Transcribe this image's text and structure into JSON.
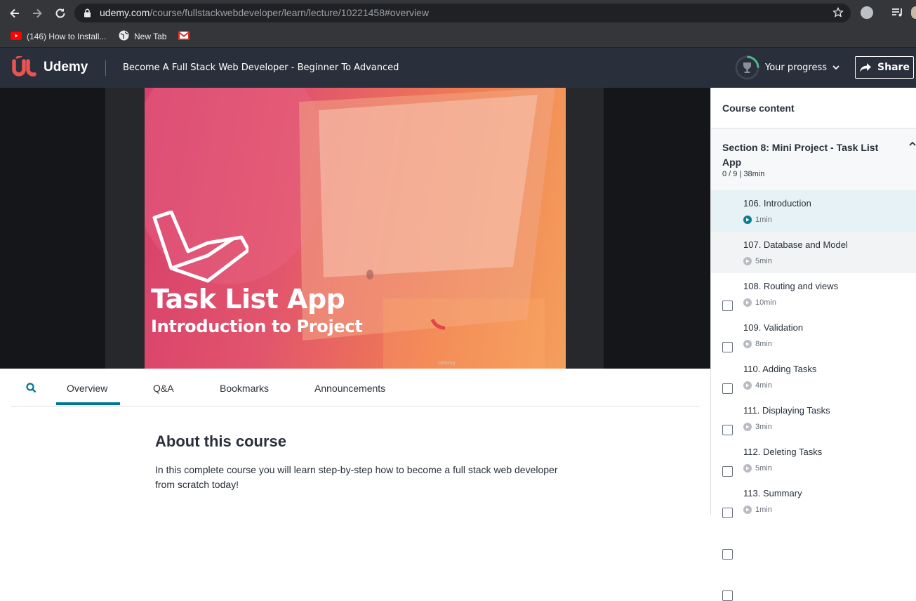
{
  "browser": {
    "url_host": "udemy.com",
    "url_path": "/course/fullstackwebdeveloper/learn/lecture/10221458#overview",
    "bookmarks": [
      {
        "label": "(146) How to Install...",
        "icon": "youtube-icon"
      },
      {
        "label": "New Tab",
        "icon": "globe-icon"
      },
      {
        "label": "",
        "icon": "gmail-icon"
      }
    ]
  },
  "header": {
    "logo_text": "Udemy",
    "course_title": "Become A Full Stack Web Developer - Beginner To Advanced",
    "progress_label": "Your progress",
    "share_label": "Share"
  },
  "video": {
    "title": "Task List App",
    "subtitle": "Introduction to Project",
    "watermark": "Udemy"
  },
  "tabs": [
    {
      "label": "Overview",
      "active": true
    },
    {
      "label": "Q&A",
      "active": false
    },
    {
      "label": "Bookmarks",
      "active": false
    },
    {
      "label": "Announcements",
      "active": false
    }
  ],
  "overview": {
    "heading": "About this course",
    "description": "In this complete course you will learn step-by-step how to become a full stack web developer from scratch today!"
  },
  "sidebar": {
    "title": "Course content",
    "section": {
      "title": "Section 8: Mini Project - Task List App",
      "meta": "0 / 9 | 38min"
    },
    "lectures": [
      {
        "title": "106. Introduction",
        "duration": "1min",
        "current": true
      },
      {
        "title": "107. Database and Model",
        "duration": "5min",
        "current": false
      },
      {
        "title": "108. Routing and views",
        "duration": "10min",
        "current": false
      },
      {
        "title": "109. Validation",
        "duration": "8min",
        "current": false
      },
      {
        "title": "110. Adding Tasks",
        "duration": "4min",
        "current": false
      },
      {
        "title": "111. Displaying Tasks",
        "duration": "3min",
        "current": false
      },
      {
        "title": "112. Deleting Tasks",
        "duration": "5min",
        "current": false
      },
      {
        "title": "113. Summary",
        "duration": "1min",
        "current": false
      }
    ]
  },
  "colors": {
    "udemy_red": "#ec5252",
    "header_bg": "#29303b",
    "accent_teal": "#007791",
    "current_row_bg": "#e6f2f5",
    "hover_row_bg": "#f2f3f5"
  }
}
